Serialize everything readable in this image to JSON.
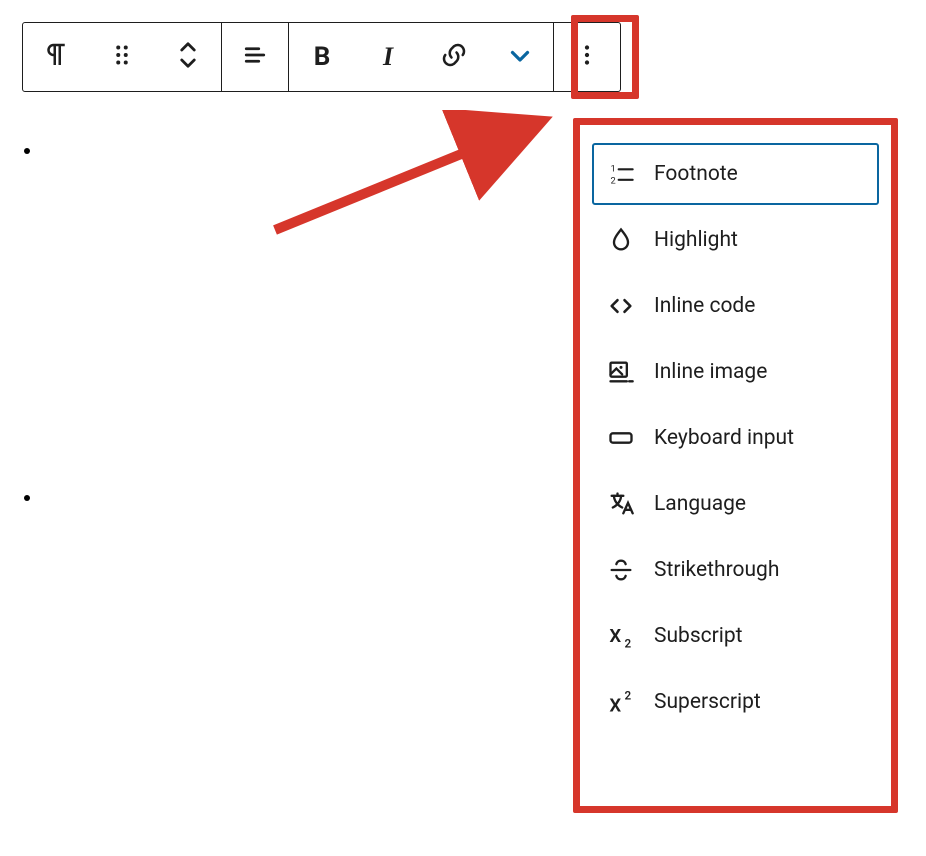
{
  "toolbar": {
    "buttons": {
      "paragraph": "paragraph",
      "drag": "drag",
      "move": "move",
      "align": "align",
      "bold": "B",
      "italic": "I",
      "link": "link",
      "more_formats": "more-formats",
      "options": "options"
    }
  },
  "menu": {
    "items": [
      {
        "icon": "footnote-icon",
        "label": "Footnote",
        "selected": true
      },
      {
        "icon": "highlight-icon",
        "label": "Highlight",
        "selected": false
      },
      {
        "icon": "inline-code-icon",
        "label": "Inline code",
        "selected": false
      },
      {
        "icon": "inline-image-icon",
        "label": "Inline image",
        "selected": false
      },
      {
        "icon": "keyboard-input-icon",
        "label": "Keyboard input",
        "selected": false
      },
      {
        "icon": "language-icon",
        "label": "Language",
        "selected": false
      },
      {
        "icon": "strikethrough-icon",
        "label": "Strikethrough",
        "selected": false
      },
      {
        "icon": "subscript-icon",
        "label": "Subscript",
        "selected": false
      },
      {
        "icon": "superscript-icon",
        "label": "Superscript",
        "selected": false
      }
    ]
  },
  "annotations": {
    "outline_color": "#d6362b",
    "accent_color": "#0a66a0"
  }
}
